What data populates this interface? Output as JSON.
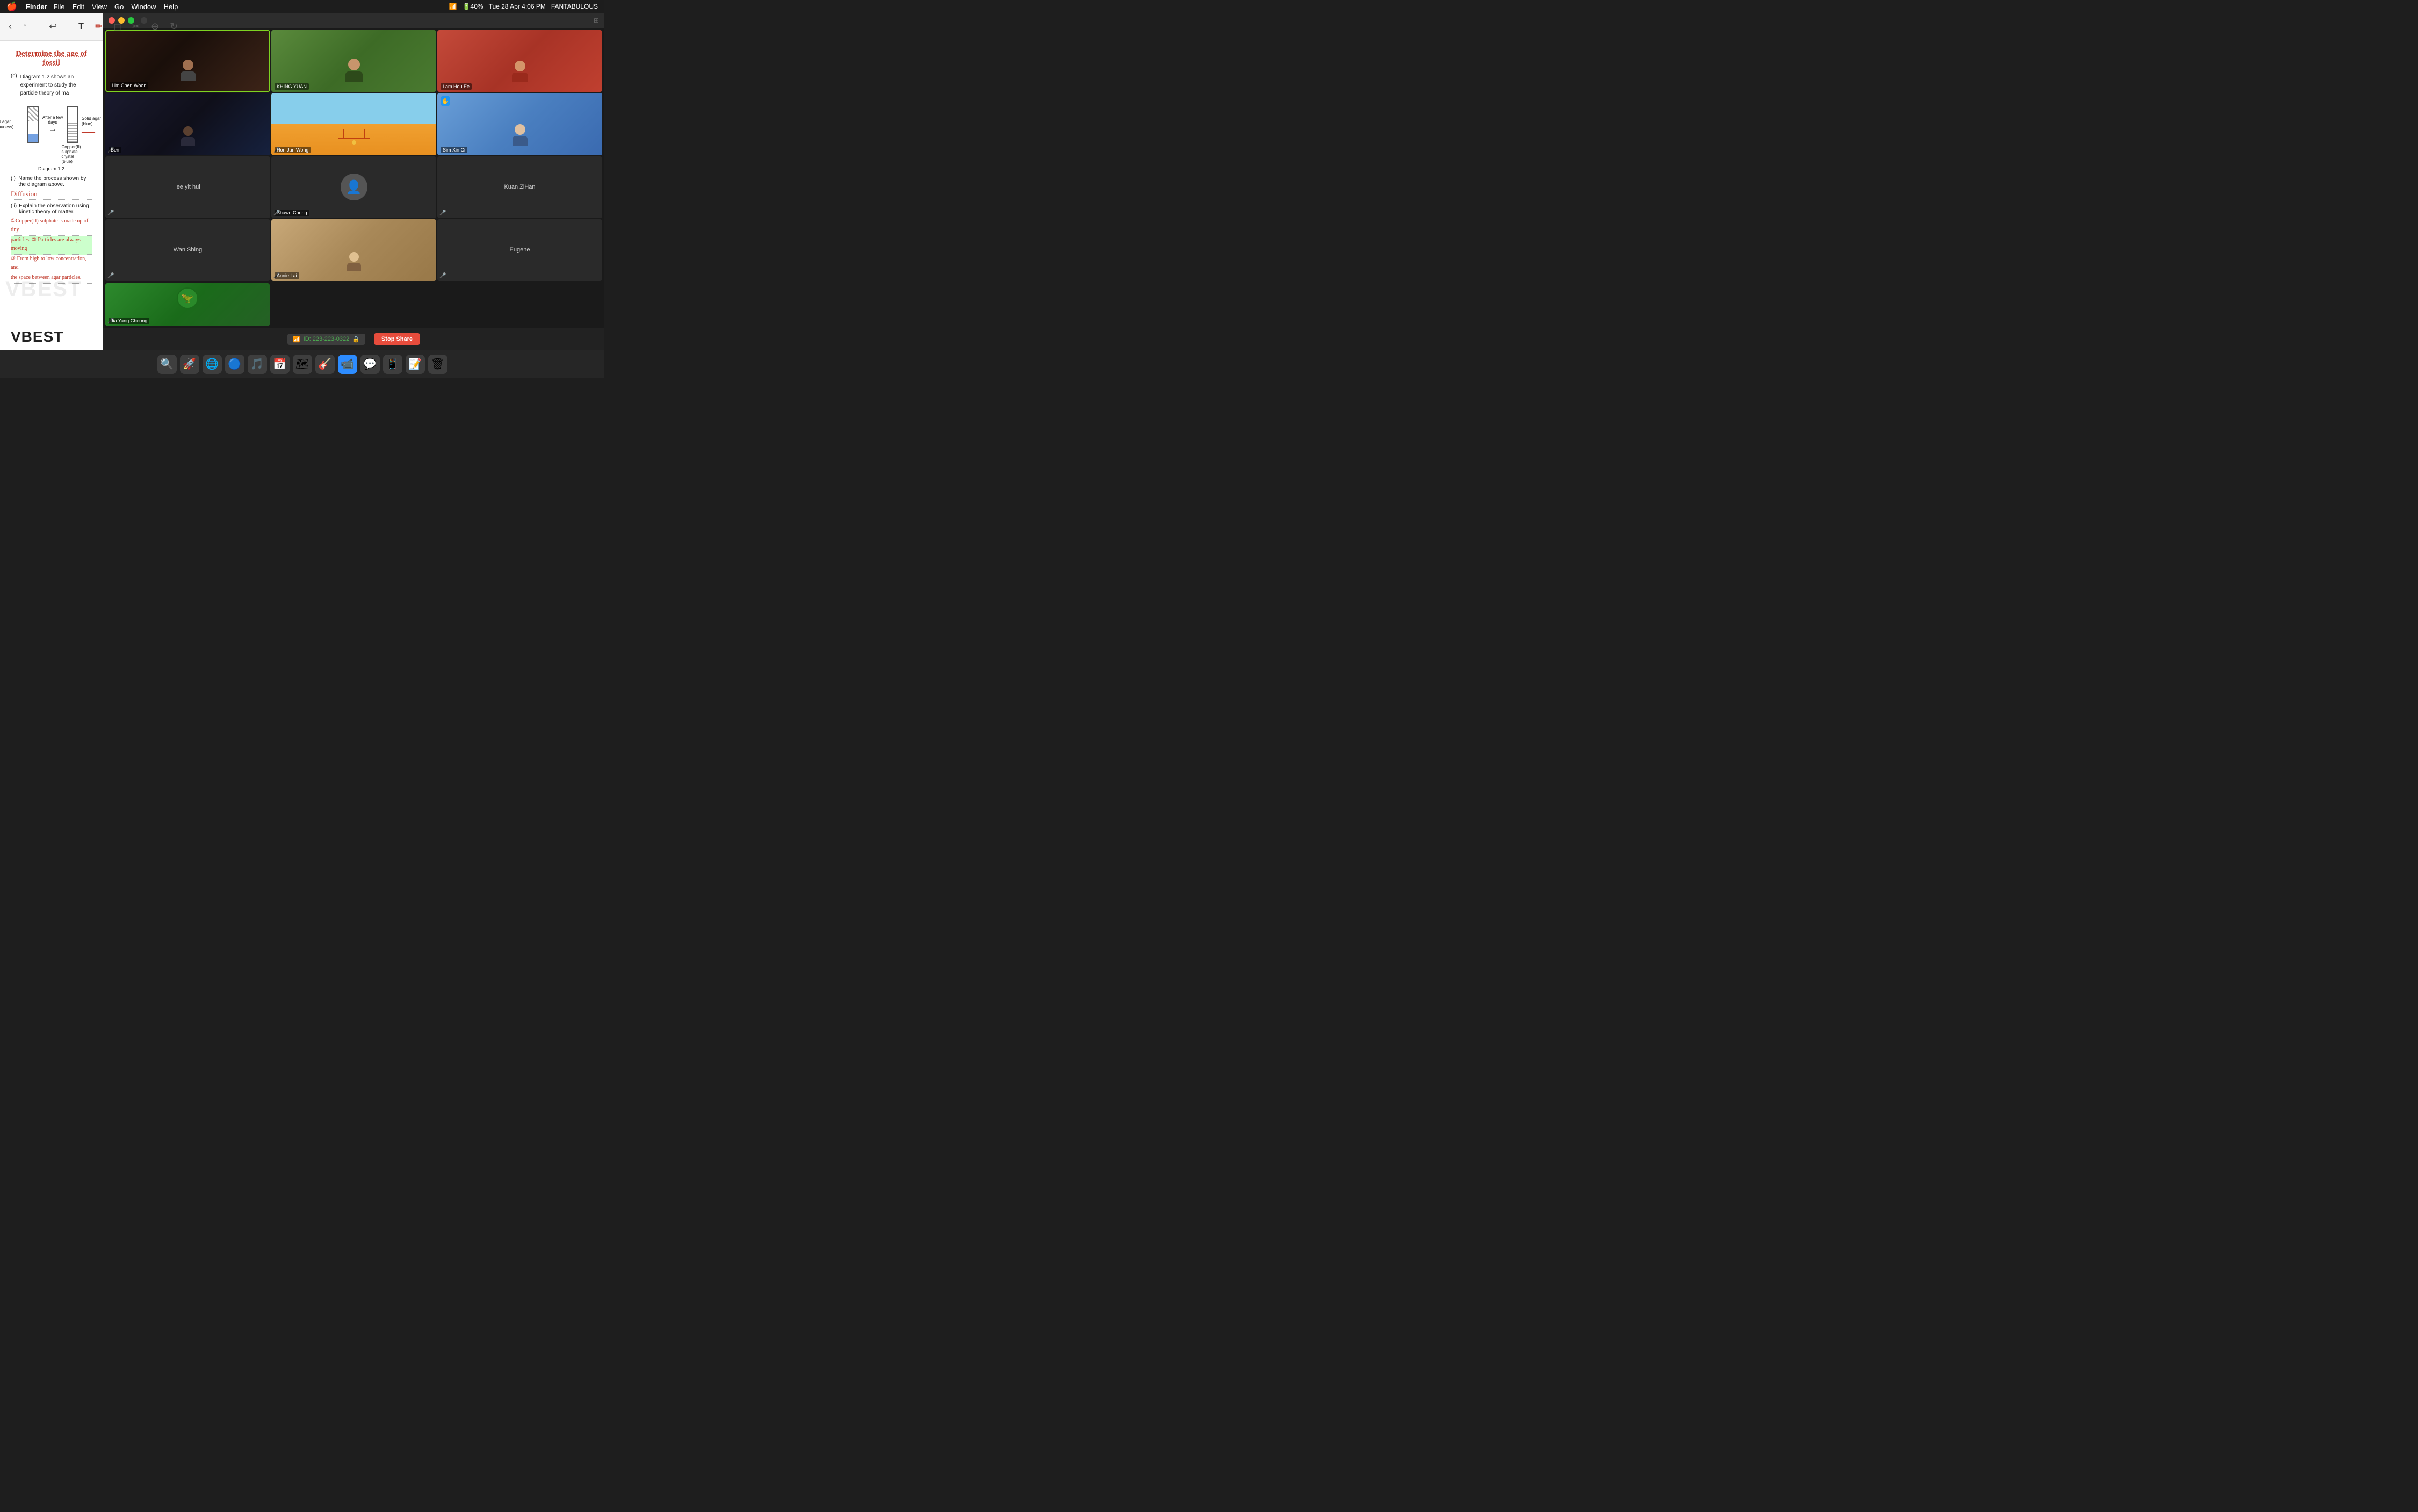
{
  "menubar": {
    "apple": "🍎",
    "app_name": "Finder",
    "menus": [
      "File",
      "Edit",
      "View",
      "Go",
      "Window",
      "Help"
    ],
    "time": "Tue 28 Apr  4:06 PM",
    "user": "FANTABULOUS",
    "battery_pct": 40
  },
  "toolbar": {
    "back_label": "‹",
    "share_label": "↑",
    "undo_label": "↩",
    "text_label": "T",
    "pencil_label": "✏",
    "eraser_label": "◻",
    "lasso_label": "✂",
    "tools_label": "⊕",
    "rotate_label": "↻"
  },
  "doc": {
    "handwriting_title": "Determine the age of fossil",
    "question_c_text": "Diagram 1.2 shows an experiment to study the particle theory of ma",
    "diagram_label_left_top": "Solid agar",
    "diagram_label_left_sub": "(colourless)",
    "diagram_label_copper": "Copper(II)",
    "diagram_label_sulphate": "sulphate",
    "diagram_label_crystal": "crystal",
    "diagram_label_blue": "(blue)",
    "diagram_arrow": "→",
    "diagram_afewdays": "After a few days",
    "diagram_right_top": "Solid agar",
    "diagram_right_sub": "(blue)",
    "diagram_caption": "Diagram 1.2",
    "question_i_label": "(i)",
    "question_i_text": "Name the process shown by the diagram above.",
    "answer_i": "Diffusion",
    "question_ii_label": "(ii)",
    "question_ii_text": "Explain the observation using kinetic theory of matter.",
    "answer_ii_1": "①Copper(II) sulphate is made up of tiny",
    "answer_ii_2": "particles. ② Particles are always moving",
    "answer_ii_3": "③ From high to low concentration, and",
    "answer_ii_4": "the space between agar particles.",
    "vbest_watermark": "VBEST",
    "vbest_logo": "VBEST"
  },
  "zoom": {
    "window_controls": {
      "close": "close",
      "minimize": "minimize",
      "maximize": "maximize"
    },
    "participants": [
      {
        "id": "lim-chen-woon",
        "name": "Lim Chen Woon",
        "has_video": true,
        "active": true,
        "muted": false,
        "bg": "room-dark"
      },
      {
        "id": "khing-yuan",
        "name": "KHING YUAN",
        "has_video": true,
        "active": false,
        "muted": false,
        "bg": "smiling"
      },
      {
        "id": "lam-hou-ee",
        "name": "Lam Hou Ee",
        "has_video": true,
        "active": false,
        "muted": false,
        "bg": "glasses"
      },
      {
        "id": "ben",
        "name": "Ben",
        "has_video": true,
        "active": false,
        "muted": true,
        "bg": "dark-person"
      },
      {
        "id": "hon-jun-wong",
        "name": "Hon Jun Wong",
        "has_video": true,
        "active": false,
        "muted": false,
        "bg": "golden-gate"
      },
      {
        "id": "sim-xin-ci",
        "name": "Sim Xin Ci",
        "has_video": true,
        "active": false,
        "hand_raised": true,
        "muted": false,
        "bg": "peace-sign"
      },
      {
        "id": "lee-yit-hui",
        "name": "lee yit hui",
        "has_video": false,
        "active": false,
        "muted": true
      },
      {
        "id": "shawn-chong",
        "name": "Shawn Chong",
        "has_video": false,
        "active": false,
        "muted": true
      },
      {
        "id": "kuan-zihan",
        "name": "Kuan ZiHan",
        "has_video": false,
        "active": false,
        "muted": true
      },
      {
        "id": "wan-shing",
        "name": "Wan Shing",
        "has_video": false,
        "active": false,
        "muted": true
      },
      {
        "id": "annie-lai",
        "name": "Annie Lai",
        "has_video": true,
        "active": false,
        "muted": true,
        "bg": "room-light-person"
      },
      {
        "id": "eugene",
        "name": "Eugene",
        "has_video": false,
        "active": false,
        "muted": true
      },
      {
        "id": "jia-yang-cheong",
        "name": "Jia Yang Cheong",
        "has_video": true,
        "active": false,
        "muted": true,
        "bg": "cartoon"
      }
    ]
  },
  "status_bar": {
    "meeting_icon": "📶",
    "meeting_id_label": "ID: 223-223-0322",
    "lock_icon": "🔒",
    "stop_share_label": "Stop Share"
  },
  "dock": {
    "items": [
      {
        "id": "finder",
        "icon": "🔍",
        "label": "Finder"
      },
      {
        "id": "launchpad",
        "icon": "🚀",
        "label": "Launchpad"
      },
      {
        "id": "arc",
        "icon": "🌐",
        "label": "Arc"
      },
      {
        "id": "chrome",
        "icon": "🔵",
        "label": "Chrome"
      },
      {
        "id": "spotify",
        "icon": "🎵",
        "label": "Spotify"
      },
      {
        "id": "calendar",
        "icon": "📅",
        "label": "Calendar"
      },
      {
        "id": "maps",
        "icon": "🗺",
        "label": "Maps"
      },
      {
        "id": "itunes",
        "icon": "🎸",
        "label": "iTunes"
      },
      {
        "id": "zoom",
        "icon": "📹",
        "label": "Zoom"
      },
      {
        "id": "whatsapp",
        "icon": "💬",
        "label": "WhatsApp"
      },
      {
        "id": "skype",
        "icon": "📱",
        "label": "Skype"
      },
      {
        "id": "word",
        "icon": "📝",
        "label": "Word"
      },
      {
        "id": "trash",
        "icon": "🗑",
        "label": "Trash"
      }
    ]
  }
}
